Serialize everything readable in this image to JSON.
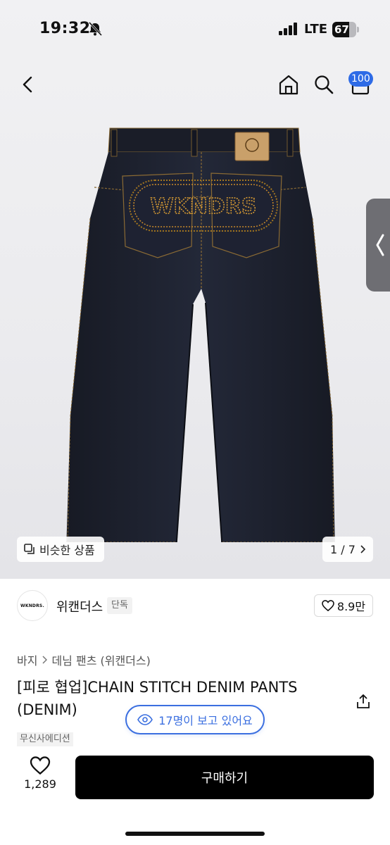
{
  "status_bar": {
    "time": "19:32",
    "network": "LTE",
    "battery": "67"
  },
  "header": {
    "cart_badge": "100"
  },
  "gallery": {
    "similar_label": "비슷한 상품",
    "pager": "1 / 7",
    "patch_text": "WKNDRS"
  },
  "brand": {
    "logo_text": "WKNDRS.",
    "name": "위캔더스",
    "tag": "단독",
    "likes": "8.9만"
  },
  "breadcrumb": [
    "바지",
    "데님 팬츠 (위캔더스)"
  ],
  "product": {
    "title_line1": "[피로 협업]CHAIN STITCH DENIM PANTS",
    "title_line2": "(DENIM)",
    "viewers": "17명이 보고 있어요",
    "store_tag": "무신사에디션"
  },
  "bottom": {
    "like_count": "1,289",
    "buy_label": "구매하기"
  },
  "colors": {
    "accent": "#3b6fe0",
    "cart_badge": "#2e6be6",
    "buy_button": "#000000",
    "denim": "#1e2230",
    "stitch": "#c98a2a"
  }
}
